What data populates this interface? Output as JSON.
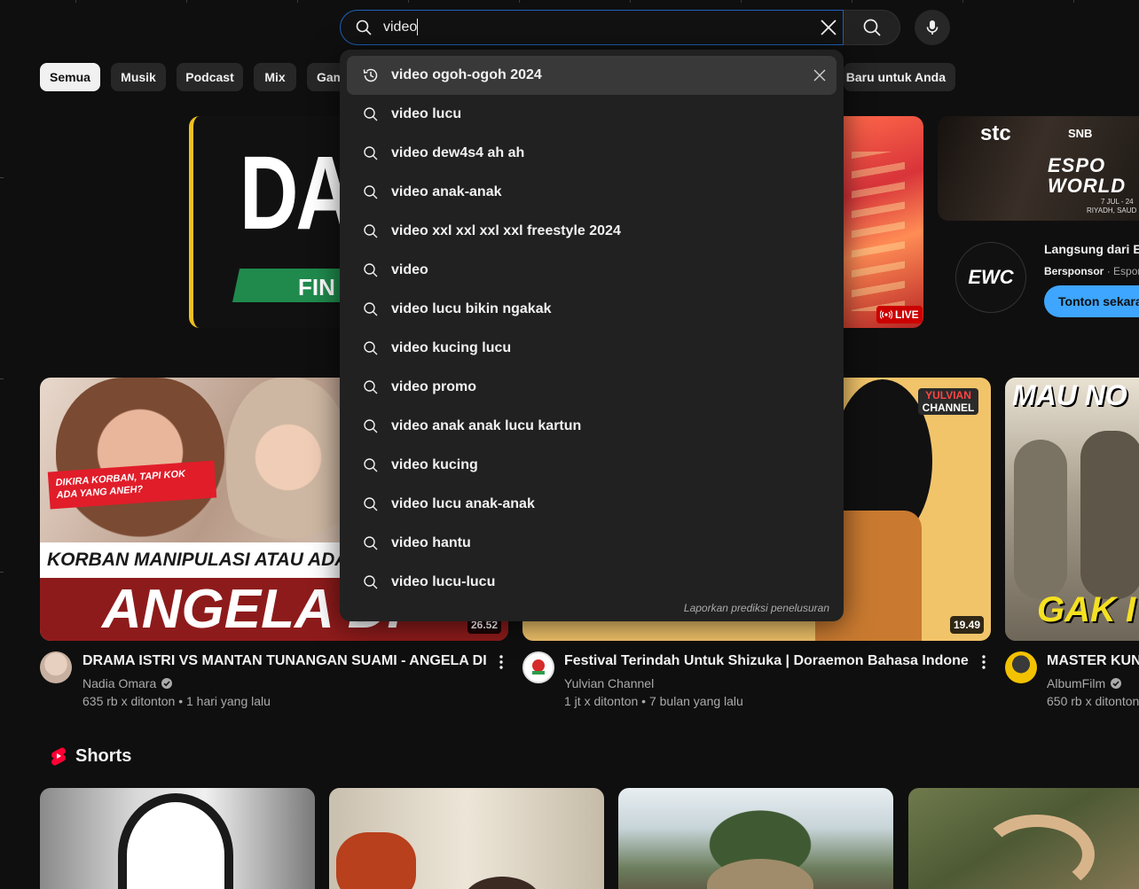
{
  "search": {
    "value": "video",
    "search_icon": "search-icon",
    "clear_icon": "close-icon",
    "mic_icon": "mic-icon"
  },
  "chips": [
    "Semua",
    "Musik",
    "Podcast",
    "Mix",
    "Gam",
    "Baru untuk Anda"
  ],
  "suggestions": {
    "items": [
      {
        "text": "video ogoh-ogoh 2024",
        "icon": "history-icon",
        "removable": true
      },
      {
        "text": "video lucu",
        "icon": "search-icon"
      },
      {
        "text": "video dew4s4 ah ah",
        "icon": "search-icon"
      },
      {
        "text": "video anak-anak",
        "icon": "search-icon"
      },
      {
        "text": "video xxl xxl xxl xxl freestyle 2024",
        "icon": "search-icon"
      },
      {
        "text": "video",
        "icon": "search-icon"
      },
      {
        "text": "video lucu bikin ngakak",
        "icon": "search-icon"
      },
      {
        "text": "video kucing lucu",
        "icon": "search-icon"
      },
      {
        "text": "video promo",
        "icon": "search-icon"
      },
      {
        "text": "video anak anak lucu kartun",
        "icon": "search-icon"
      },
      {
        "text": "video kucing",
        "icon": "search-icon"
      },
      {
        "text": "video lucu anak-anak",
        "icon": "search-icon"
      },
      {
        "text": "video hantu",
        "icon": "search-icon"
      },
      {
        "text": "video lucu-lucu",
        "icon": "search-icon"
      }
    ],
    "report_label": "Laporkan prediksi penelusuran"
  },
  "hero": {
    "left_big_text": "DA",
    "left_banner_text": "FIN",
    "live_badge": "LIVE"
  },
  "ad": {
    "brand_text": "stc",
    "brand2_text": "SNB",
    "thumb_title": "ESPO WORLD",
    "thumb_date": "7 JUL - 24",
    "thumb_place": "RIYADH, SAUD",
    "channel_logo": "EWC",
    "title": "Langsung dari Es",
    "sponsor_label": "Bersponsor",
    "sponsor_name": "Espor",
    "cta": "Tonton sekarang"
  },
  "videos": [
    {
      "title": "DRAMA ISTRI VS MANTAN TUNANGAN SUAMI - ANGELA DIAZ",
      "channel": "Nadia Omara",
      "verified": true,
      "views": "635 rb x ditonton",
      "age": "1 hari yang lalu",
      "duration": "26.52",
      "thumb_tag": "DIKIRA KORBAN, TAPI KOK ADA YANG ANEH?",
      "thumb_line": "KORBAN MANIPULASI ATAU ADA YG D",
      "thumb_big": "ANGELA DI"
    },
    {
      "title": "Festival Terindah Untuk Shizuka | Doraemon Bahasa Indonesia",
      "channel": "Yulvian Channel",
      "verified": false,
      "views": "1 jt x ditonton",
      "age": "7 bulan yang lalu",
      "duration": "19.49",
      "thumb_logo_1": "YULVIAN",
      "thumb_logo_2": "CHANNEL"
    },
    {
      "title": "MASTER KUNG",
      "channel": "AlbumFilm",
      "verified": true,
      "views": "650 rb x ditonton",
      "age": "",
      "thumb_top": "MAU NO",
      "thumb_bottom": "GAK I"
    }
  ],
  "shorts": {
    "title": "Shorts",
    "icon": "shorts-icon"
  },
  "colors": {
    "background": "#0f0f0f",
    "chip": "#272727",
    "dropdown": "#212121",
    "focus": "#1c62b9",
    "cta": "#3ea6ff",
    "live": "#ff0000"
  }
}
